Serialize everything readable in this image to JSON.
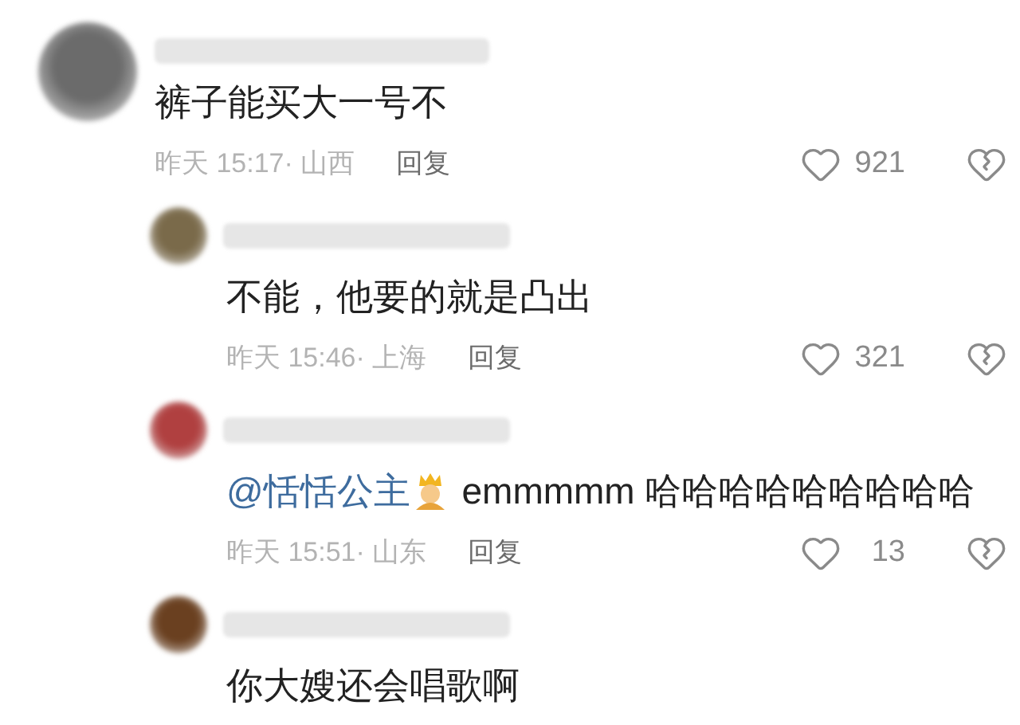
{
  "comments": [
    {
      "kind": "top",
      "text": "裤子能买大一号不",
      "meta": "昨天 15:17· 山西",
      "reply": "回复",
      "likes": "921"
    },
    {
      "kind": "reply",
      "text": "不能，他要的就是凸出",
      "meta": "昨天 15:46· 上海",
      "reply": "回复",
      "likes": "321"
    },
    {
      "kind": "reply",
      "mention": "@恬恬公主",
      "text": " emmmmm 哈哈哈哈哈哈哈哈哈",
      "meta": "昨天 15:51· 山东",
      "reply": "回复",
      "likes": "13"
    },
    {
      "kind": "reply",
      "text": "你大嫂还会唱歌啊"
    }
  ]
}
